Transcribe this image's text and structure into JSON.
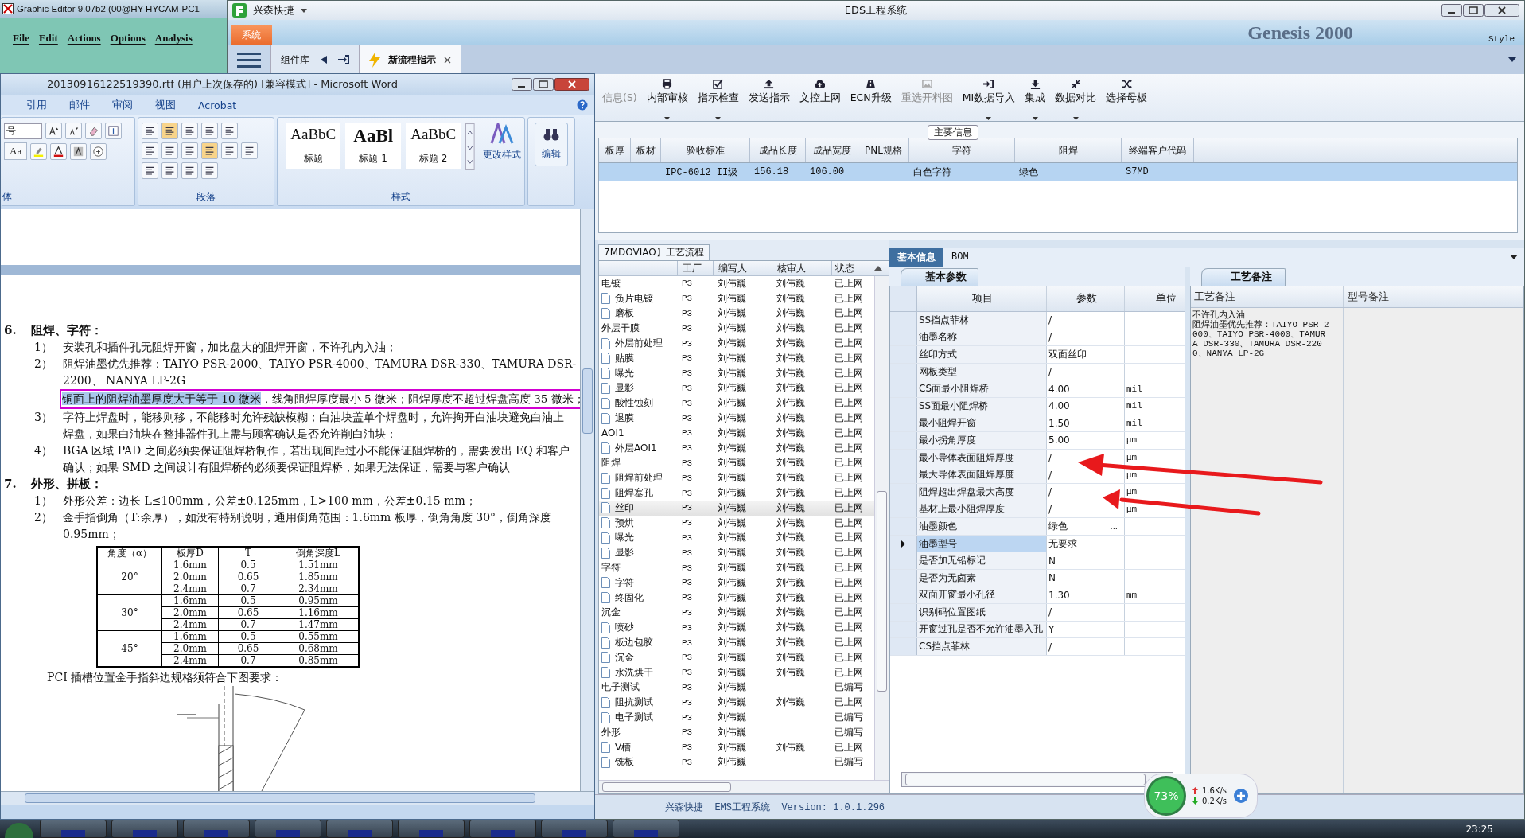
{
  "graphic_editor": {
    "title": "Graphic Editor 9.07b2 (00@HY-HYCAM-PC1",
    "menu": [
      "File",
      "Edit",
      "Actions",
      "Options",
      "Analysis"
    ]
  },
  "eds": {
    "app_name": "兴森快捷",
    "title": "EDS工程系统",
    "system_tab": "系统",
    "backdrop": {
      "product": "Genesis 2000",
      "style": "Style"
    },
    "tabs": [
      {
        "label": "组件库",
        "selected": false,
        "kind": "library"
      },
      {
        "label": "新流程指示",
        "selected": true,
        "kind": "document"
      }
    ],
    "toolbar": [
      {
        "label": "信息(S)",
        "disabled": true,
        "dropdown": false
      },
      {
        "label": "内部审核",
        "disabled": false,
        "dropdown": true
      },
      {
        "label": "指示检查",
        "disabled": false,
        "dropdown": true
      },
      {
        "label": "发送指示",
        "disabled": false,
        "dropdown": false
      },
      {
        "label": "文控上网",
        "disabled": false,
        "dropdown": false
      },
      {
        "label": "ECN升级",
        "disabled": false,
        "dropdown": false
      },
      {
        "label": "重选开料图",
        "disabled": true,
        "dropdown": false
      },
      {
        "label": "MI数据导入",
        "disabled": false,
        "dropdown": true
      },
      {
        "label": "集成",
        "disabled": false,
        "dropdown": true
      },
      {
        "label": "数据对比",
        "disabled": false,
        "dropdown": true
      },
      {
        "label": "选择母板",
        "disabled": false,
        "dropdown": false
      }
    ],
    "main_info": {
      "legend": "主要信息",
      "columns": [
        "板厚",
        "板材",
        "验收标准",
        "成品长度",
        "成品宽度",
        "PNL规格",
        "字符",
        "阻焊",
        "终端客户代码"
      ],
      "rows": [
        {
          "selected": true,
          "cells": [
            null,
            null,
            "IPC-6012 II级",
            "156.18",
            "106.00",
            null,
            "白色字符",
            "绿色",
            "S7MD"
          ]
        }
      ]
    },
    "process": {
      "tab": "7MDOVIAO】工艺流程",
      "columns": [
        "工厂",
        "编写人",
        "核审人",
        "状态"
      ],
      "groups": [
        {
          "name": "电镀",
          "factory": "P3",
          "writer": "刘伟巍",
          "reviewer": "刘伟巍",
          "status": "已上网",
          "selected": false,
          "children": [
            {
              "name": "负片电镀",
              "factory": "P3",
              "writer": "刘伟巍",
              "reviewer": "刘伟巍",
              "status": "已上网",
              "selected": false
            },
            {
              "name": "磨板",
              "factory": "P3",
              "writer": "刘伟巍",
              "reviewer": "刘伟巍",
              "status": "已上网",
              "selected": false
            }
          ]
        },
        {
          "name": "外层干膜",
          "factory": "P3",
          "writer": "刘伟巍",
          "reviewer": "刘伟巍",
          "status": "已上网",
          "selected": false,
          "children": [
            {
              "name": "外层前处理",
              "factory": "P3",
              "writer": "刘伟巍",
              "reviewer": "刘伟巍",
              "status": "已上网",
              "selected": false
            },
            {
              "name": "贴膜",
              "factory": "P3",
              "writer": "刘伟巍",
              "reviewer": "刘伟巍",
              "status": "已上网",
              "selected": false
            },
            {
              "name": "曝光",
              "factory": "P3",
              "writer": "刘伟巍",
              "reviewer": "刘伟巍",
              "status": "已上网",
              "selected": false
            },
            {
              "name": "显影",
              "factory": "P3",
              "writer": "刘伟巍",
              "reviewer": "刘伟巍",
              "status": "已上网",
              "selected": false
            },
            {
              "name": "酸性蚀刻",
              "factory": "P3",
              "writer": "刘伟巍",
              "reviewer": "刘伟巍",
              "status": "已上网",
              "selected": false
            },
            {
              "name": "退膜",
              "factory": "P3",
              "writer": "刘伟巍",
              "reviewer": "刘伟巍",
              "status": "已上网",
              "selected": false
            }
          ]
        },
        {
          "name": "AOI1",
          "factory": "P3",
          "writer": "刘伟巍",
          "reviewer": "刘伟巍",
          "status": "已上网",
          "selected": false,
          "children": [
            {
              "name": "外层AOI1",
              "factory": "P3",
              "writer": "刘伟巍",
              "reviewer": "刘伟巍",
              "status": "已上网",
              "selected": false
            }
          ]
        },
        {
          "name": "阻焊",
          "factory": "P3",
          "writer": "刘伟巍",
          "reviewer": "刘伟巍",
          "status": "已上网",
          "selected": false,
          "children": [
            {
              "name": "阻焊前处理",
              "factory": "P3",
              "writer": "刘伟巍",
              "reviewer": "刘伟巍",
              "status": "已上网",
              "selected": false
            },
            {
              "name": "阻焊塞孔",
              "factory": "P3",
              "writer": "刘伟巍",
              "reviewer": "刘伟巍",
              "status": "已上网",
              "selected": false
            },
            {
              "name": "丝印",
              "factory": "P3",
              "writer": "刘伟巍",
              "reviewer": "刘伟巍",
              "status": "已上网",
              "selected": true
            },
            {
              "name": "预烘",
              "factory": "P3",
              "writer": "刘伟巍",
              "reviewer": "刘伟巍",
              "status": "已上网",
              "selected": false
            },
            {
              "name": "曝光",
              "factory": "P3",
              "writer": "刘伟巍",
              "reviewer": "刘伟巍",
              "status": "已上网",
              "selected": false
            },
            {
              "name": "显影",
              "factory": "P3",
              "writer": "刘伟巍",
              "reviewer": "刘伟巍",
              "status": "已上网",
              "selected": false
            }
          ]
        },
        {
          "name": "字符",
          "factory": "P3",
          "writer": "刘伟巍",
          "reviewer": "刘伟巍",
          "status": "已上网",
          "selected": false,
          "children": [
            {
              "name": "字符",
              "factory": "P3",
              "writer": "刘伟巍",
              "reviewer": "刘伟巍",
              "status": "已上网",
              "selected": false
            },
            {
              "name": "终固化",
              "factory": "P3",
              "writer": "刘伟巍",
              "reviewer": "刘伟巍",
              "status": "已上网",
              "selected": false
            }
          ]
        },
        {
          "name": "沉金",
          "factory": "P3",
          "writer": "刘伟巍",
          "reviewer": "刘伟巍",
          "status": "已上网",
          "selected": false,
          "children": [
            {
              "name": "喷砂",
              "factory": "P3",
              "writer": "刘伟巍",
              "reviewer": "刘伟巍",
              "status": "已上网",
              "selected": false
            },
            {
              "name": "板边包胶",
              "factory": "P3",
              "writer": "刘伟巍",
              "reviewer": "刘伟巍",
              "status": "已上网",
              "selected": false
            },
            {
              "name": "沉金",
              "factory": "P3",
              "writer": "刘伟巍",
              "reviewer": "刘伟巍",
              "status": "已上网",
              "selected": false
            },
            {
              "name": "水洗烘干",
              "factory": "P3",
              "writer": "刘伟巍",
              "reviewer": "刘伟巍",
              "status": "已上网",
              "selected": false
            }
          ]
        },
        {
          "name": "电子测试",
          "factory": "P3",
          "writer": "刘伟巍",
          "status": "已编写",
          "selected": false,
          "children": [
            {
              "name": "阻抗测试",
              "factory": "P3",
              "writer": "刘伟巍",
              "reviewer": "刘伟巍",
              "status": "已上网",
              "selected": false
            },
            {
              "name": "电子测试",
              "factory": "P3",
              "writer": "刘伟巍",
              "status": "已编写",
              "selected": false
            }
          ]
        },
        {
          "name": "外形",
          "factory": "P3",
          "writer": "刘伟巍",
          "status": "已编写",
          "selected": false,
          "children": [
            {
              "name": "V槽",
              "factory": "P3",
              "writer": "刘伟巍",
              "reviewer": "刘伟巍",
              "status": "已上网",
              "selected": false
            },
            {
              "name": "铣板",
              "factory": "P3",
              "writer": "刘伟巍",
              "status": "已编写",
              "selected": false
            }
          ]
        }
      ]
    },
    "detail": {
      "tabs": [
        {
          "label": "基本信息",
          "selected": true
        },
        {
          "label": "BOM",
          "selected": false
        }
      ],
      "subtab": "基本参数",
      "columns": [
        "项目",
        "参数",
        "单位"
      ],
      "rows": [
        {
          "item": "SS挡点菲林",
          "value": "/",
          "selected": false
        },
        {
          "item": "油墨名称",
          "value": "/",
          "selected": false
        },
        {
          "item": "丝印方式",
          "value": "双面丝印",
          "selected": false
        },
        {
          "item": "网板类型",
          "value": "/",
          "selected": false
        },
        {
          "item": "CS面最小阻焊桥",
          "value": "4.00",
          "unit": "mil",
          "selected": false
        },
        {
          "item": "SS面最小阻焊桥",
          "value": "4.00",
          "unit": "mil",
          "selected": false
        },
        {
          "item": "最小阻焊开窗",
          "value": "1.50",
          "unit": "mil",
          "selected": false
        },
        {
          "item": "最小拐角厚度",
          "value": "5.00",
          "unit": "μm",
          "selected": false
        },
        {
          "item": "最小导体表面阻焊厚度",
          "value": "/",
          "unit": "μm",
          "selected": false
        },
        {
          "item": "最大导体表面阻焊厚度",
          "value": "/",
          "unit": "μm",
          "selected": false
        },
        {
          "item": "阻焊超出焊盘最大高度",
          "value": "/",
          "unit": "μm",
          "selected": false
        },
        {
          "item": "基材上最小阻焊厚度",
          "value": "/",
          "unit": "μm",
          "selected": false
        },
        {
          "item": "油墨颜色",
          "value": "绿色",
          "selected": false,
          "button": "..."
        },
        {
          "item": "油墨型号",
          "value": "无要求",
          "selected": true
        },
        {
          "item": "是否加无铅标记",
          "value": "N",
          "selected": false
        },
        {
          "item": "是否为无卤素",
          "value": "N",
          "selected": false
        },
        {
          "item": "双面开窗最小孔径",
          "value": "1.30",
          "unit": "mm",
          "selected": false
        },
        {
          "item": "识别码位置图纸",
          "value": "/",
          "selected": false
        },
        {
          "item": "开窗过孔是否不允许油墨入孔",
          "value": "Y",
          "selected": false
        },
        {
          "item": "CS挡点菲林",
          "value": "/",
          "selected": false
        }
      ]
    },
    "notes": {
      "tab": "工艺备注",
      "columns": [
        "工艺备注",
        "型号备注"
      ],
      "lines": [
        "不许孔内入油",
        "阻焊油墨优先推荐：TAIYO PSR-2000、TAIYO PSR-4000、TAMURA DSR-330、TAMURA DSR-2200、NANYA LP-2G"
      ]
    },
    "status": "兴森快捷  EMS工程系统  Version: 1.0.1.296"
  },
  "word": {
    "title": "20130916122519390.rtf (用户上次保存的) [兼容模式] - Microsoft Word",
    "tabs": [
      "引用",
      "邮件",
      "审阅",
      "视图",
      "Acrobat"
    ],
    "font_field": "号",
    "change_case": "Aa",
    "groups": [
      "体",
      "段落",
      "样式"
    ],
    "styles": [
      {
        "preview": "AaBbC",
        "label": "标题"
      },
      {
        "preview": "AaBl",
        "label": "标题 1"
      },
      {
        "preview": "AaBbC",
        "label": "标题 2"
      }
    ],
    "change_styles": "更改样式",
    "edit": "编辑",
    "sections": [
      {
        "num": "6.",
        "title": "阻焊、字符：",
        "items": [
          {
            "num": "1）",
            "text": "安装孔和插件孔无阻焊开窗，加比盘大的阻焊开窗，不许孔内入油；"
          },
          {
            "num": "2）",
            "text": "阻焊油墨优先推荐：TAIYO PSR-2000、TAIYO PSR-4000、TAMURA  DSR-330、TAMURA DSR-2200、 NANYA LP-2G",
            "highlight": {
              "selected": "铜面上的阻焊油墨厚度大于等于 10 微米",
              "rest": "，线角阻焊厚度最小 5 微米；阻焊厚度不超过焊盘高度 35 微米；"
            }
          },
          {
            "num": "3）",
            "text": "字符上焊盘时，能移则移，不能移时允许残缺模糊；白油块盖单个焊盘时，允许掏开白油块避免白油上焊盘，如果白油块在整排器件孔上需与顾客确认是否允许削白油块；"
          },
          {
            "num": "4）",
            "text": "BGA 区域 PAD 之间必须要保证阻焊桥制作，若出现间距过小不能保证阻焊桥的，需要发出 EQ 和客户确认；如果 SMD 之间设计有阻焊桥的必须要保证阻焊桥，如果无法保证，需要与客户确认"
          }
        ]
      },
      {
        "num": "7.",
        "title": "外形、拼板：",
        "items": [
          {
            "num": "1）",
            "text": "外形公差：边长 L≤100mm，公差±0.125mm，L>100 mm，公差±0.15 mm；"
          },
          {
            "num": "2）",
            "text": "金手指倒角（T:余厚），如没有特别说明，通用倒角范围：1.6mm 板厚，倒角角度 30°，倒角深度 0.95mm；"
          }
        ]
      }
    ],
    "table": {
      "columns": [
        "角度（α）",
        "板厚D",
        "T",
        "倒角深度L"
      ],
      "groups": [
        {
          "angle": "20°",
          "rows": [
            [
              "1.6mm",
              "0.5",
              "1.51mm"
            ],
            [
              "2.0mm",
              "0.65",
              "1.85mm"
            ],
            [
              "2.4mm",
              "0.7",
              "2.34mm"
            ]
          ]
        },
        {
          "angle": "30°",
          "rows": [
            [
              "1.6mm",
              "0.5",
              "0.95mm"
            ],
            [
              "2.0mm",
              "0.65",
              "1.16mm"
            ],
            [
              "2.4mm",
              "0.7",
              "1.47mm"
            ]
          ]
        },
        {
          "angle": "45°",
          "rows": [
            [
              "1.6mm",
              "0.5",
              "0.55mm"
            ],
            [
              "2.0mm",
              "0.65",
              "0.68mm"
            ],
            [
              "2.4mm",
              "0.7",
              "0.85mm"
            ]
          ]
        }
      ]
    },
    "caption": "PCI 插槽位置金手指斜边规格须符合下图要求："
  },
  "tray": {
    "load": "73%",
    "up": "1.6K/s",
    "down": "0.2K/s"
  },
  "taskbar": {
    "clock": "23:25"
  }
}
